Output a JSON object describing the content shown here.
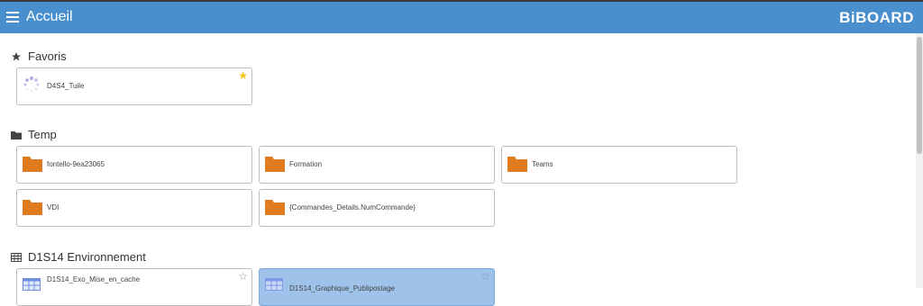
{
  "header": {
    "title": "Accueil",
    "logo": "BiBOARD",
    "bg_color": "#4a8fcd"
  },
  "sections": {
    "favoris": {
      "title": "Favoris",
      "icon": "star-icon",
      "items": [
        {
          "label": "D4S4_Tuile",
          "icon": "spinner-icon",
          "starred": true
        }
      ]
    },
    "temp": {
      "title": "Temp",
      "icon": "folder-icon",
      "items": [
        {
          "label": "fontello-9ea23065",
          "icon": "folder-icon"
        },
        {
          "label": "Formation",
          "icon": "folder-icon"
        },
        {
          "label": "Teams",
          "icon": "folder-icon"
        },
        {
          "label": "VDI",
          "icon": "folder-icon"
        },
        {
          "label": "{Commandes_Details.NumCommande}",
          "icon": "folder-icon"
        }
      ]
    },
    "environnement": {
      "title": "D1S14 Environnement",
      "icon": "table-icon",
      "items": [
        {
          "label": "D1S14_Exo_Mise_en_cache",
          "icon": "table-icon",
          "starred": false
        },
        {
          "label": "D1S14_Graphique_Publipostage",
          "icon": "table-icon",
          "starred": false,
          "selected": true
        }
      ]
    }
  },
  "colors": {
    "folder": "#e07b1f",
    "star_active": "#f0c419",
    "selected_tile": "#9ec2e9"
  }
}
